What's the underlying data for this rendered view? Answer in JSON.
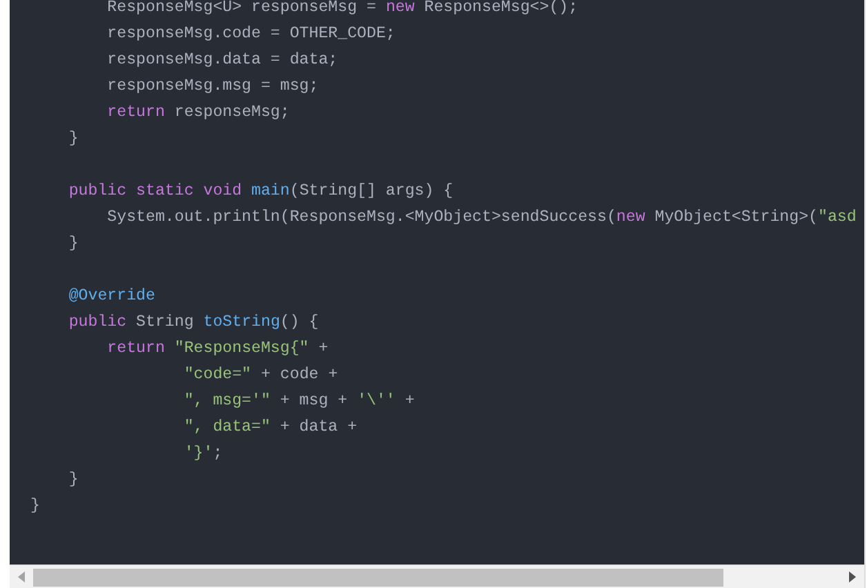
{
  "code_lines": [
    {
      "kind": "code",
      "tokens": [
        {
          "kind": "plain",
          "text": "        ResponseMsg<U> responseMsg = "
        },
        {
          "kind": "keyword",
          "text": "new"
        },
        {
          "kind": "plain",
          "text": " ResponseMsg<>();"
        }
      ]
    },
    {
      "kind": "code",
      "tokens": [
        {
          "kind": "plain",
          "text": "        responseMsg.code = OTHER_CODE;"
        }
      ]
    },
    {
      "kind": "code",
      "tokens": [
        {
          "kind": "plain",
          "text": "        responseMsg.data = data;"
        }
      ]
    },
    {
      "kind": "code",
      "tokens": [
        {
          "kind": "plain",
          "text": "        responseMsg.msg = msg;"
        }
      ]
    },
    {
      "kind": "code",
      "tokens": [
        {
          "kind": "keyword",
          "text": "        return"
        },
        {
          "kind": "plain",
          "text": " responseMsg;"
        }
      ]
    },
    {
      "kind": "code",
      "tokens": [
        {
          "kind": "plain",
          "text": "    }"
        }
      ]
    },
    {
      "kind": "blank"
    },
    {
      "kind": "code",
      "tokens": [
        {
          "kind": "keyword",
          "text": "    public static void"
        },
        {
          "kind": "function",
          "text": " main"
        },
        {
          "kind": "plain",
          "text": "(String[] args) {"
        }
      ]
    },
    {
      "kind": "code",
      "tokens": [
        {
          "kind": "plain",
          "text": "        System.out.println(ResponseMsg.<MyObject>sendSuccess("
        },
        {
          "kind": "keyword",
          "text": "new"
        },
        {
          "kind": "plain",
          "text": " MyObject<String>("
        },
        {
          "kind": "string",
          "text": "\"asd"
        }
      ]
    },
    {
      "kind": "code",
      "tokens": [
        {
          "kind": "plain",
          "text": "    }"
        }
      ]
    },
    {
      "kind": "blank"
    },
    {
      "kind": "code",
      "tokens": [
        {
          "kind": "annotation",
          "text": "    @Override"
        }
      ]
    },
    {
      "kind": "code",
      "tokens": [
        {
          "kind": "keyword",
          "text": "    public"
        },
        {
          "kind": "plain",
          "text": " String "
        },
        {
          "kind": "function",
          "text": "toString"
        },
        {
          "kind": "plain",
          "text": "() {"
        }
      ]
    },
    {
      "kind": "code",
      "tokens": [
        {
          "kind": "keyword",
          "text": "        return"
        },
        {
          "kind": "string",
          "text": " \"ResponseMsg{\""
        },
        {
          "kind": "plain",
          "text": " +"
        }
      ]
    },
    {
      "kind": "code",
      "tokens": [
        {
          "kind": "string",
          "text": "                \"code=\""
        },
        {
          "kind": "plain",
          "text": " + code +"
        }
      ]
    },
    {
      "kind": "code",
      "tokens": [
        {
          "kind": "string",
          "text": "                \", msg='\""
        },
        {
          "kind": "plain",
          "text": " + msg + "
        },
        {
          "kind": "string",
          "text": "'\\''"
        },
        {
          "kind": "plain",
          "text": " +"
        }
      ]
    },
    {
      "kind": "code",
      "tokens": [
        {
          "kind": "string",
          "text": "                \", data=\""
        },
        {
          "kind": "plain",
          "text": " + data +"
        }
      ]
    },
    {
      "kind": "code",
      "tokens": [
        {
          "kind": "string",
          "text": "                '}'"
        },
        {
          "kind": "plain",
          "text": ";"
        }
      ]
    },
    {
      "kind": "code",
      "tokens": [
        {
          "kind": "plain",
          "text": "    }"
        }
      ]
    },
    {
      "kind": "code",
      "tokens": [
        {
          "kind": "plain",
          "text": "}"
        }
      ]
    }
  ]
}
